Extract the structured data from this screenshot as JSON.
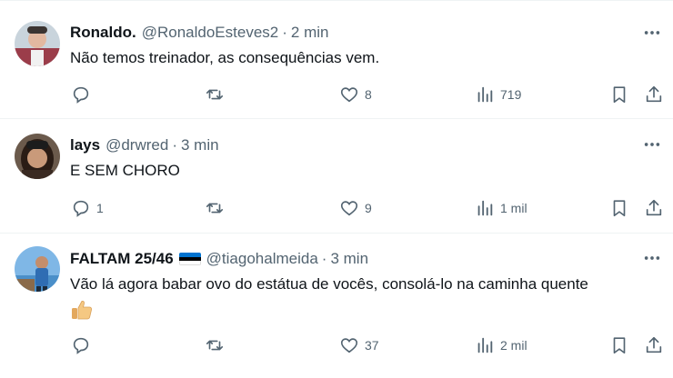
{
  "tweets": [
    {
      "name": "Ronaldo.",
      "handle": "@RonaldoEsteves2",
      "separator": "·",
      "time": "2 min",
      "text": "Não temos treinador, as consequências vem.",
      "replies": "",
      "likes": "8",
      "views": "719"
    },
    {
      "name": "lays",
      "handle": "@drwred",
      "separator": "·",
      "time": "3 min",
      "text": "E SEM CHORO",
      "replies": "1",
      "likes": "9",
      "views": "1 mil"
    },
    {
      "name": "FALTAM 25/46",
      "handle": "@tiagohalmeida",
      "separator": "·",
      "time": "3 min",
      "text": "Vão lá agora babar ovo do estátua de vocês, consolá-lo na caminha quente",
      "replies": "",
      "likes": "37",
      "views": "2 mil"
    }
  ],
  "icons": {
    "more": "more-dots-icon",
    "reply": "reply-icon",
    "retweet": "retweet-icon",
    "like": "heart-icon",
    "views": "views-icon",
    "bookmark": "bookmark-icon",
    "share": "share-icon",
    "flag": "estonia-flag-icon",
    "emoji": "thumbs-up-icon"
  },
  "colors": {
    "text": "#0f1419",
    "secondary": "#536471",
    "divider": "#eff3f4",
    "flag_blue": "#0072ce",
    "flag_black": "#000000",
    "flag_white": "#ffffff"
  }
}
